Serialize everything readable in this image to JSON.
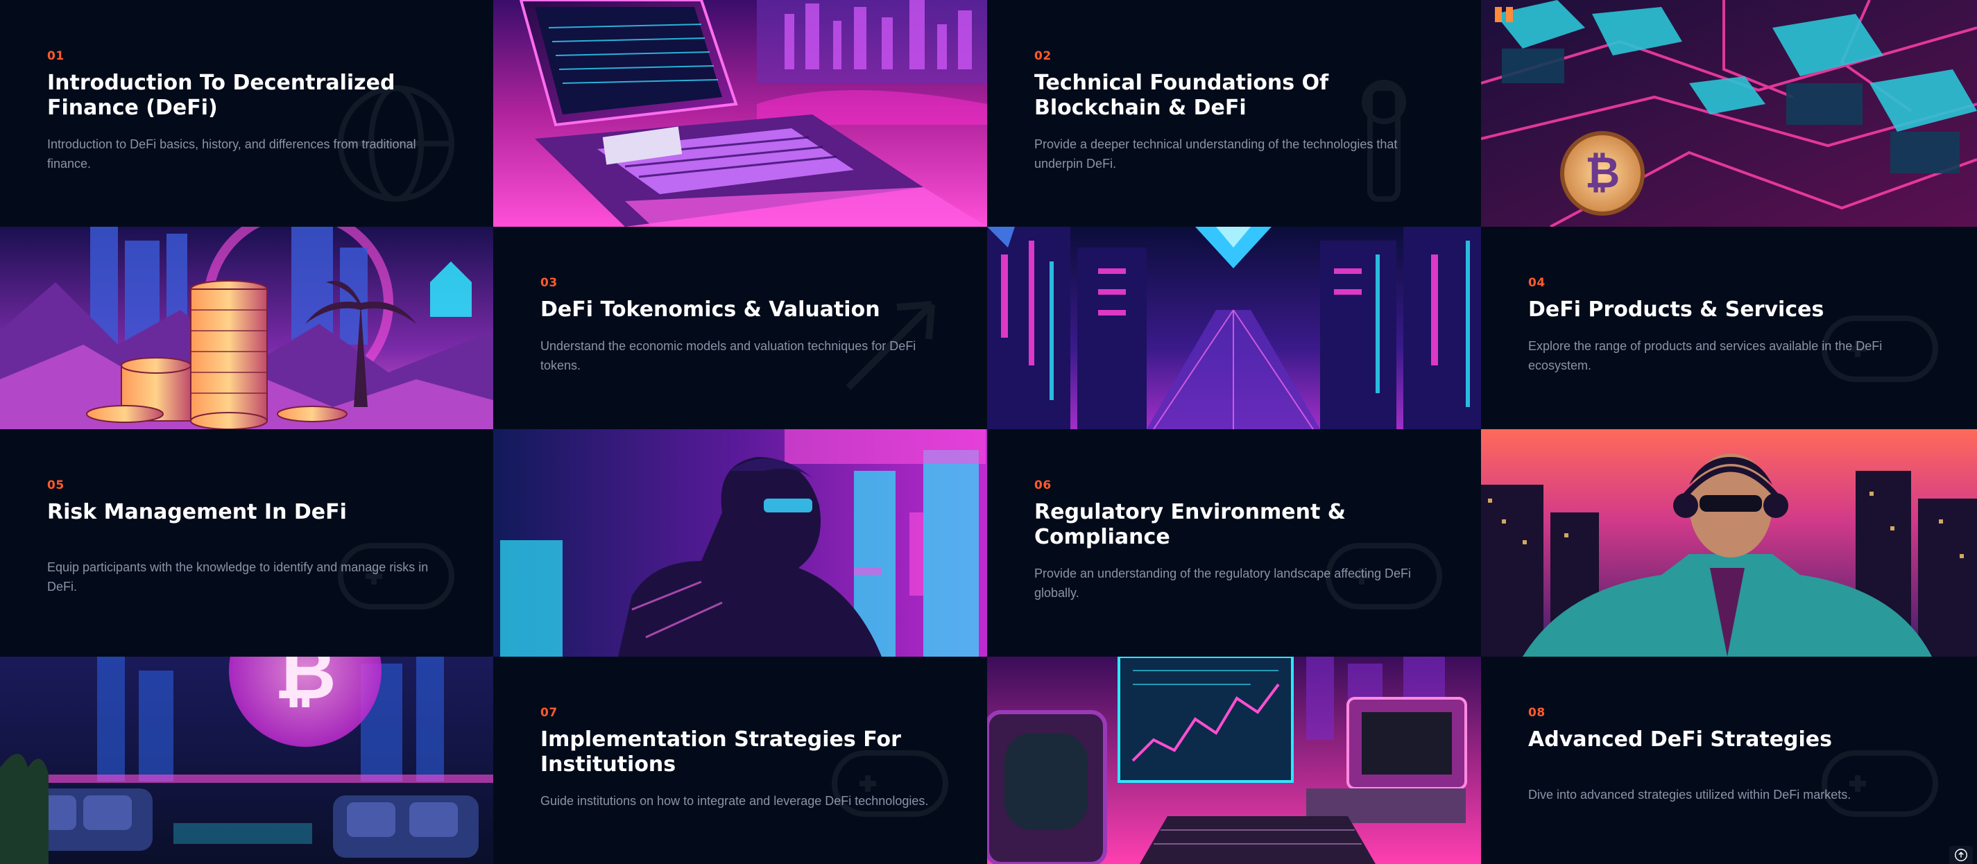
{
  "modules": [
    {
      "num": "01",
      "title": "Introduction To Decentralized Finance (DeFi)",
      "desc": "Introduction to DeFi basics, history, and differences from traditional finance.",
      "bg_icon": "globe-icon"
    },
    {
      "num": "02",
      "title": "Technical Foundations Of Blockchain & DeFi",
      "desc": "Provide a deeper technical understanding of the technologies that underpin DeFi.",
      "bg_icon": "wrench-icon"
    },
    {
      "num": "03",
      "title": "DeFi Tokenomics & Valuation",
      "desc": "Understand the economic models and valuation techniques for DeFi tokens.",
      "bg_icon": "arrows-icon"
    },
    {
      "num": "04",
      "title": "DeFi Products & Services",
      "desc": "Explore the range of products and services available in the DeFi ecosystem.",
      "bg_icon": "gamepad-icon"
    },
    {
      "num": "05",
      "title": "Risk Management In DeFi",
      "desc": "Equip participants with the knowledge to identify and manage risks in DeFi.",
      "bg_icon": "gamepad-icon"
    },
    {
      "num": "06",
      "title": "Regulatory Environment & Compliance",
      "desc": "Provide an understanding of the regulatory landscape affecting DeFi globally.",
      "bg_icon": "gamepad-icon"
    },
    {
      "num": "07",
      "title": "Implementation Strategies For Institutions",
      "desc": "Guide institutions on how to integrate and leverage DeFi technologies.",
      "bg_icon": "gamepad-icon"
    },
    {
      "num": "08",
      "title": "Advanced DeFi Strategies",
      "desc": "Dive into advanced strategies utilized within DeFi markets.",
      "bg_icon": "gamepad-icon"
    }
  ],
  "images": [
    "retro-laptop-illustration",
    "neon-circuit-bitcoin-illustration",
    "neon-coin-stack-illustration",
    "neon-city-corridor-illustration",
    "neon-hacker-portrait-illustration",
    "neon-businessman-illustration",
    "neon-lounge-bitcoin-illustration",
    "retro-computer-trading-illustration"
  ],
  "scroll_top_icon": "arrow-up-circle-icon",
  "colors": {
    "background": "#030b1a",
    "accent": "#ff5a2c",
    "title": "#ffffff",
    "text": "#8b93a7",
    "neon_pink": "#ff2fd1",
    "neon_cyan": "#2ee6ff",
    "neon_purple": "#7b2cff"
  }
}
